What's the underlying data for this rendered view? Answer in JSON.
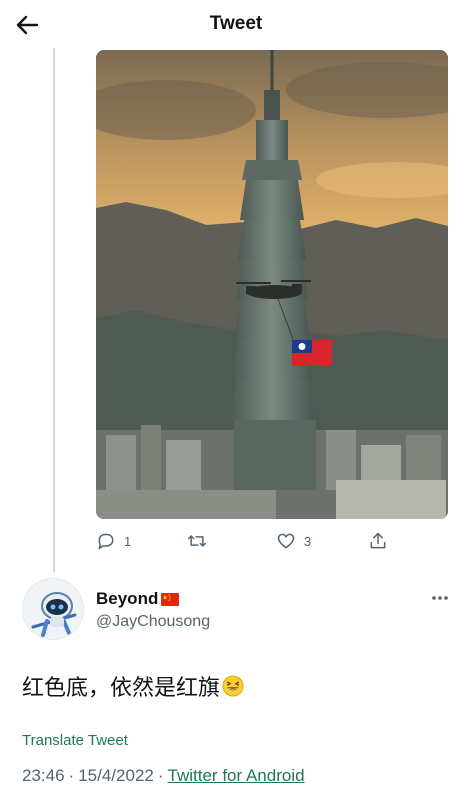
{
  "header": {
    "title": "Tweet",
    "back_icon": "arrow-left-icon"
  },
  "media": {
    "description_icon": "photo"
  },
  "actions": {
    "reply_count": "1",
    "retweet_count": "",
    "like_count": "3",
    "share_count": ""
  },
  "author": {
    "name": "Beyond",
    "handle": "@JayChousong",
    "name_emoji": "china-flag-icon"
  },
  "tweet": {
    "text": "红色底，依然是红旗"
  },
  "footer": {
    "translate_label": "Translate Tweet",
    "time": "23:46",
    "separator": "·",
    "date": "15/4/2022",
    "separator2": "·",
    "source": "Twitter for Android"
  },
  "colors": {
    "text": "#0f1419",
    "muted": "#536471",
    "link": "#1d7a55",
    "thread_line": "#cfd9de"
  }
}
